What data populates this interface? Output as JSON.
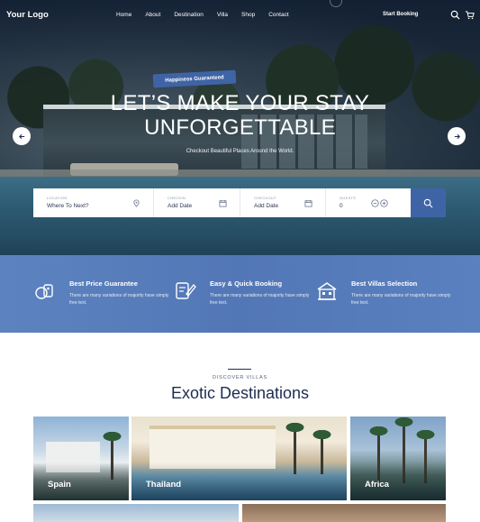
{
  "nav": {
    "logo": "Your Logo",
    "items": [
      {
        "label": "Home"
      },
      {
        "label": "About"
      },
      {
        "label": "Destination"
      },
      {
        "label": "Villa"
      },
      {
        "label": "Shop"
      },
      {
        "label": "Contact"
      }
    ],
    "cta": "Start Booking",
    "icons": [
      "search-icon",
      "cart-icon"
    ]
  },
  "hero": {
    "badge": "Happiness Guaranteed",
    "headline_line1": "LET’S MAKE YOUR STAY",
    "headline_line2": "UNFORGETTABLE",
    "subline": "Checkout Beautiful Places Around the World.",
    "prev_icon": "arrow-left-icon",
    "next_icon": "arrow-right-icon"
  },
  "search": {
    "location": {
      "label": "LOCATION",
      "value": "Where To Next?",
      "icon": "location-pin-icon"
    },
    "checkin": {
      "label": "CHECKIN",
      "value": "Add Date",
      "icon": "calendar-icon"
    },
    "checkout": {
      "label": "CHECKOUT",
      "value": "Add Date",
      "icon": "calendar-icon"
    },
    "guests": {
      "label": "GUESTS",
      "value": "0",
      "icons": [
        "minus-icon",
        "plus-icon"
      ]
    },
    "button_icon": "search-icon"
  },
  "features": [
    {
      "title": "Best Price Guarantee",
      "desc": "There are many variations of majority have simply free text.",
      "icon": "price-tag-icon"
    },
    {
      "title": "Easy & Quick Booking",
      "desc": "There are many variations of majority have simply free text.",
      "icon": "booking-icon"
    },
    {
      "title": "Best Villas Selection",
      "desc": "There are many variations of majority have simply free text.",
      "icon": "villa-icon"
    }
  ],
  "destinations": {
    "eyebrow": "DISCOVER VILLAS",
    "title": "Exotic Destinations",
    "cards": [
      {
        "name": "Spain"
      },
      {
        "name": "Thailand"
      },
      {
        "name": "Africa"
      }
    ]
  },
  "colors": {
    "accent": "#3f64a6",
    "band": "#5a7fbd",
    "navy": "#1d2d50"
  }
}
